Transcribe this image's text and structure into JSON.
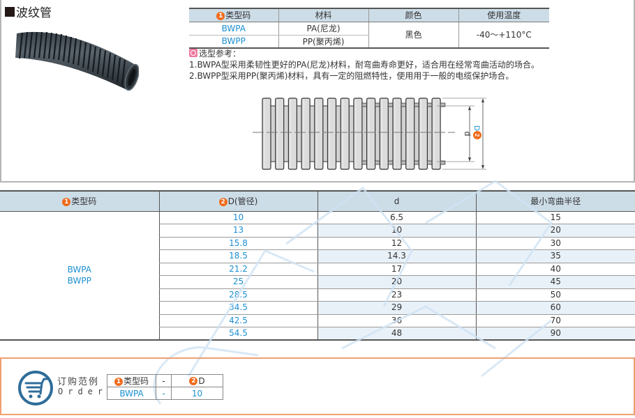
{
  "title": "波纹管",
  "spec_table": {
    "headers": [
      {
        "badge": "1",
        "label": "类型码"
      },
      {
        "label": "材料"
      },
      {
        "label": "颜色"
      },
      {
        "label": "使用温度"
      }
    ],
    "rows": [
      {
        "type": "BWPA",
        "material": "PA(尼龙)"
      },
      {
        "type": "BWPP",
        "material": "PP(聚丙烯)"
      }
    ],
    "color": "黑色",
    "temperature": "-40～+110°C"
  },
  "notes": {
    "heading": "选型参考：",
    "items": [
      "1.BWPA型采用柔韧性更好的PA(尼龙)材料，耐弯曲寿命更好，适合用在经常弯曲活动的场合。",
      "2.BWPP型采用PP(聚丙烯)材料，具有一定的阻燃特性，使用用于一般的电缆保护场合。"
    ]
  },
  "diagram": {
    "inner_label": "d",
    "outer_badge": "2",
    "outer_label": "D"
  },
  "main_table": {
    "headers": [
      {
        "badge": "1",
        "label": "类型码"
      },
      {
        "badge": "2",
        "label": "D(管径)"
      },
      {
        "label": "d"
      },
      {
        "label": "最小弯曲半径"
      }
    ],
    "types": [
      "BWPA",
      "BWPP"
    ],
    "rows": [
      {
        "D": "10",
        "d": "6.5",
        "r": "15"
      },
      {
        "D": "13",
        "d": "10",
        "r": "20"
      },
      {
        "D": "15.8",
        "d": "12",
        "r": "30"
      },
      {
        "D": "18.5",
        "d": "14.3",
        "r": "35"
      },
      {
        "D": "21.2",
        "d": "17",
        "r": "40"
      },
      {
        "D": "25",
        "d": "20",
        "r": "45"
      },
      {
        "D": "28.5",
        "d": "23",
        "r": "50"
      },
      {
        "D": "34.5",
        "d": "29",
        "r": "60"
      },
      {
        "D": "42.5",
        "d": "36",
        "r": "70"
      },
      {
        "D": "54.5",
        "d": "48",
        "r": "90"
      }
    ]
  },
  "order": {
    "label_cn": "订购范例",
    "label_en": "Order",
    "icon": "shopping-cart-icon",
    "header": [
      {
        "badge": "1",
        "label": "类型码"
      },
      {
        "label": "-"
      },
      {
        "badge": "2",
        "label": "D"
      }
    ],
    "values": [
      "BWPA",
      "-",
      "10"
    ]
  },
  "colors": {
    "accent_orange": "#ef6b1b",
    "link_blue": "#1b8fd1",
    "header_bg": "#cddde8",
    "stripe_bg": "#e9f1f8",
    "order_border": "#f0a070",
    "cart_blue": "#2f6d9a"
  }
}
